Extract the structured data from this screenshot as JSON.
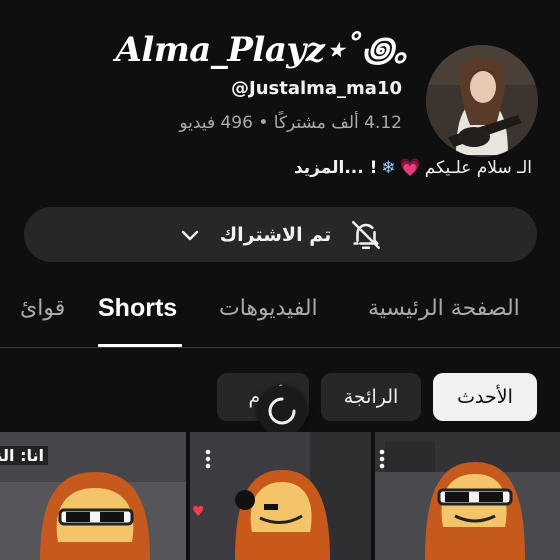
{
  "channel": {
    "name": "Alma_Playz⋆˚꩜｡",
    "handle": "@Justalma_ma10",
    "stats": "4.12 ألف مشتركًا • 496 فيديو",
    "bio_prefix": "الـ سلام علـيكم",
    "bio_heart": "💗",
    "bio_flake": "❄",
    "bio_suffix": "! ...المزيد"
  },
  "subscribe": {
    "label": "تم الاشتراك",
    "bell_icon": "bell-off-icon",
    "chevron_icon": "chevron-down-icon"
  },
  "tabs": [
    {
      "label": "الصفحة الرئيسية",
      "active": false
    },
    {
      "label": "الفيديوهات",
      "active": false
    },
    {
      "label": "Shorts",
      "active": true
    },
    {
      "label": "قوائ",
      "active": false
    }
  ],
  "filters": [
    {
      "label": "الأحدث",
      "selected": true
    },
    {
      "label": "الرائجة",
      "selected": false
    },
    {
      "label": "الأقدم",
      "selected": false
    }
  ],
  "thumbnails": [
    {
      "overlay": ""
    },
    {
      "overlay": ""
    },
    {
      "overlay": "انا: النس"
    }
  ],
  "colors": {
    "background": "#0f0f0f",
    "chip_active": "#f1f1f1",
    "chip_inactive": "#272727",
    "text_secondary": "#aaaaaa"
  }
}
